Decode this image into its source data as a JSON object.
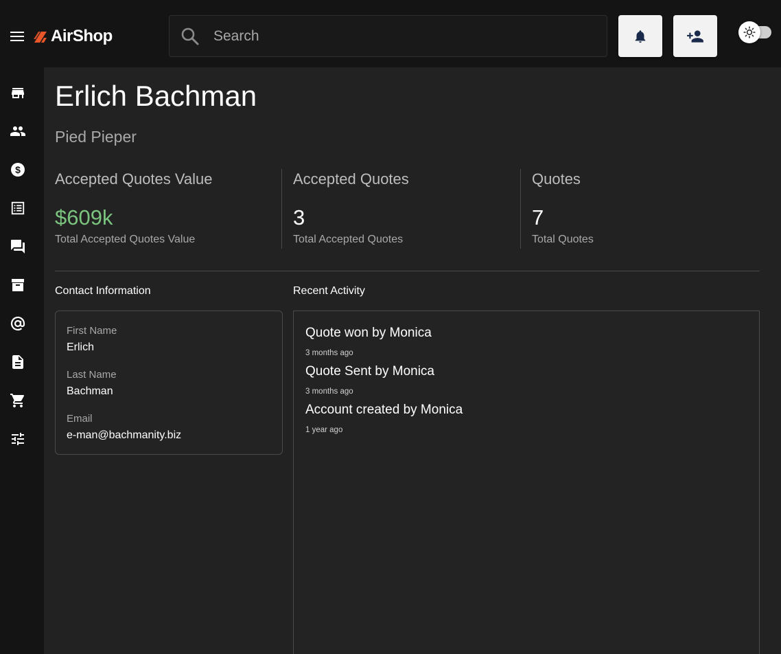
{
  "app": {
    "name": "AirShop"
  },
  "search": {
    "placeholder": "Search"
  },
  "colors": {
    "accent_logo": "#e8562a",
    "stat_green": "#7bc47f",
    "icon_dark": "#1a2a4a"
  },
  "header": {
    "buttons": [
      {
        "icon": "bell-icon"
      },
      {
        "icon": "add-user-icon"
      }
    ],
    "theme_toggle": {
      "icon": "sun-icon",
      "state": "light"
    }
  },
  "sidebar": {
    "items": [
      {
        "icon": "store-icon"
      },
      {
        "icon": "people-icon"
      },
      {
        "icon": "dollar-icon"
      },
      {
        "icon": "list-icon"
      },
      {
        "icon": "forum-icon"
      },
      {
        "icon": "archive-icon"
      },
      {
        "icon": "at-icon"
      },
      {
        "icon": "document-icon"
      },
      {
        "icon": "cart-icon"
      },
      {
        "icon": "tune-icon"
      }
    ]
  },
  "contact": {
    "name": "Erlich Bachman",
    "company": "Pied Pieper"
  },
  "stats": [
    {
      "label": "Accepted Quotes Value",
      "value": "$609k",
      "caption": "Total Accepted Quotes Value"
    },
    {
      "label": "Accepted Quotes",
      "value": "3",
      "caption": "Total Accepted Quotes"
    },
    {
      "label": "Quotes",
      "value": "7",
      "caption": "Total Quotes"
    }
  ],
  "contact_info": {
    "title": "Contact Information",
    "fields": [
      {
        "label": "First Name",
        "value": "Erlich"
      },
      {
        "label": "Last Name",
        "value": "Bachman"
      },
      {
        "label": "Email",
        "value": "e-man@bachmanity.biz"
      }
    ]
  },
  "activity": {
    "title": "Recent Activity",
    "items": [
      {
        "text": "Quote won by Monica",
        "time": "3 months ago"
      },
      {
        "text": "Quote Sent by Monica",
        "time": "3 months ago"
      },
      {
        "text": "Account created by Monica",
        "time": "1 year ago"
      }
    ]
  }
}
